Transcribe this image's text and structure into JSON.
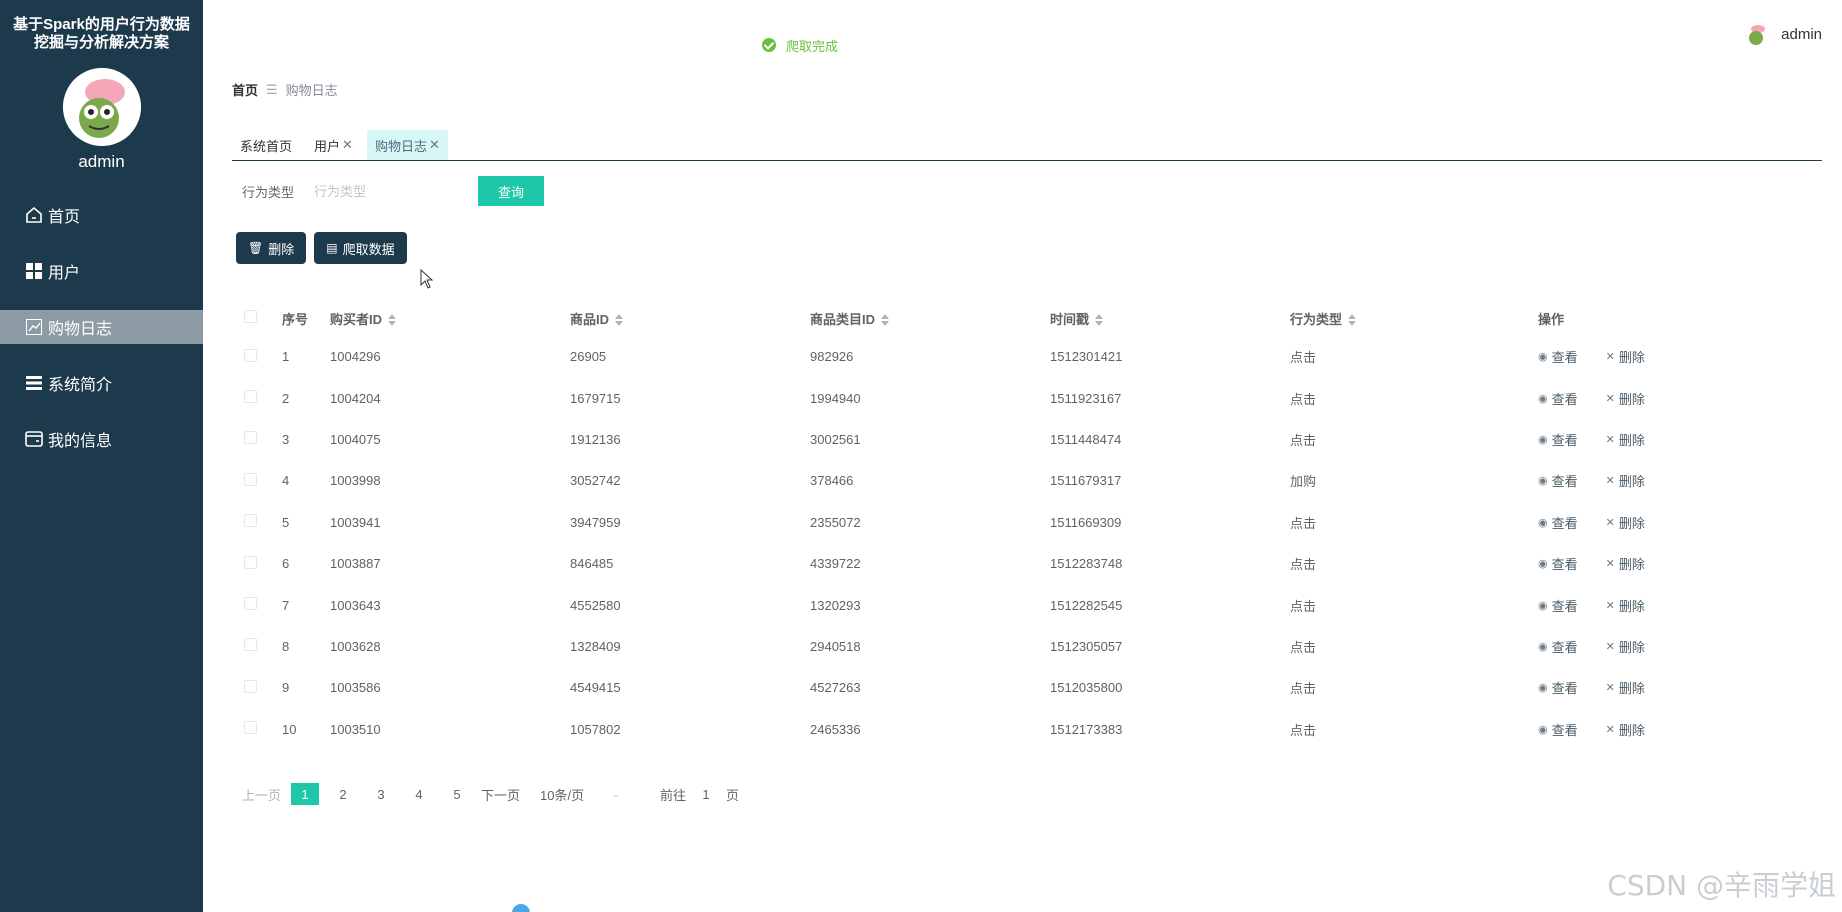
{
  "sidebar": {
    "system_title": "基于Spark的用户行为数据挖掘与分析解决方案",
    "user_name": "admin",
    "items": [
      {
        "label": "首页",
        "icon": "home-icon",
        "active": false
      },
      {
        "label": "用户",
        "icon": "grid-icon",
        "active": false
      },
      {
        "label": "购物日志",
        "icon": "chart-icon",
        "active": true
      },
      {
        "label": "系统简介",
        "icon": "list-icon",
        "active": false
      },
      {
        "label": "我的信息",
        "icon": "card-icon",
        "active": false
      }
    ]
  },
  "toast": {
    "message": "爬取完成",
    "color": "#67c23a"
  },
  "header": {
    "user_name": "admin"
  },
  "breadcrumb": {
    "home": "首页",
    "current": "购物日志"
  },
  "tabs": [
    {
      "label": "系统首页",
      "closable": false,
      "active": false
    },
    {
      "label": "用户",
      "closable": true,
      "active": false
    },
    {
      "label": "购物日志",
      "closable": true,
      "active": true
    }
  ],
  "search": {
    "label": "行为类型",
    "placeholder": "行为类型",
    "button_label": "查询"
  },
  "actions": {
    "delete_label": "删除",
    "crawl_label": "爬取数据"
  },
  "table": {
    "headers": {
      "index": "序号",
      "buyer_id": "购买者ID",
      "goods_id": "商品ID",
      "category_id": "商品类目ID",
      "timestamp": "时间戳",
      "behavior": "行为类型",
      "operation": "操作"
    },
    "view_label": "查看",
    "delete_label": "删除",
    "rows": [
      {
        "index": "1",
        "buyer_id": "1004296",
        "goods_id": "26905",
        "category_id": "982926",
        "timestamp": "1512301421",
        "behavior": "点击"
      },
      {
        "index": "2",
        "buyer_id": "1004204",
        "goods_id": "1679715",
        "category_id": "1994940",
        "timestamp": "1511923167",
        "behavior": "点击"
      },
      {
        "index": "3",
        "buyer_id": "1004075",
        "goods_id": "1912136",
        "category_id": "3002561",
        "timestamp": "1511448474",
        "behavior": "点击"
      },
      {
        "index": "4",
        "buyer_id": "1003998",
        "goods_id": "3052742",
        "category_id": "378466",
        "timestamp": "1511679317",
        "behavior": "加购"
      },
      {
        "index": "5",
        "buyer_id": "1003941",
        "goods_id": "3947959",
        "category_id": "2355072",
        "timestamp": "1511669309",
        "behavior": "点击"
      },
      {
        "index": "6",
        "buyer_id": "1003887",
        "goods_id": "846485",
        "category_id": "4339722",
        "timestamp": "1512283748",
        "behavior": "点击"
      },
      {
        "index": "7",
        "buyer_id": "1003643",
        "goods_id": "4552580",
        "category_id": "1320293",
        "timestamp": "1512282545",
        "behavior": "点击"
      },
      {
        "index": "8",
        "buyer_id": "1003628",
        "goods_id": "1328409",
        "category_id": "2940518",
        "timestamp": "1512305057",
        "behavior": "点击"
      },
      {
        "index": "9",
        "buyer_id": "1003586",
        "goods_id": "4549415",
        "category_id": "4527263",
        "timestamp": "1512035800",
        "behavior": "点击"
      },
      {
        "index": "10",
        "buyer_id": "1003510",
        "goods_id": "1057802",
        "category_id": "2465336",
        "timestamp": "1512173383",
        "behavior": "点击"
      }
    ]
  },
  "pagination": {
    "prev": "上一页",
    "pages": [
      "1",
      "2",
      "3",
      "4",
      "5"
    ],
    "current": "1",
    "next": "下一页",
    "page_size": "10条/页",
    "goto_prefix": "前往",
    "goto_value": "1",
    "goto_suffix": "页"
  },
  "watermark": "CSDN @辛雨学姐",
  "colors": {
    "sidebar_bg": "#1d3a4c",
    "accent": "#1dc7a8",
    "active_menu": "#8d9ba4"
  }
}
